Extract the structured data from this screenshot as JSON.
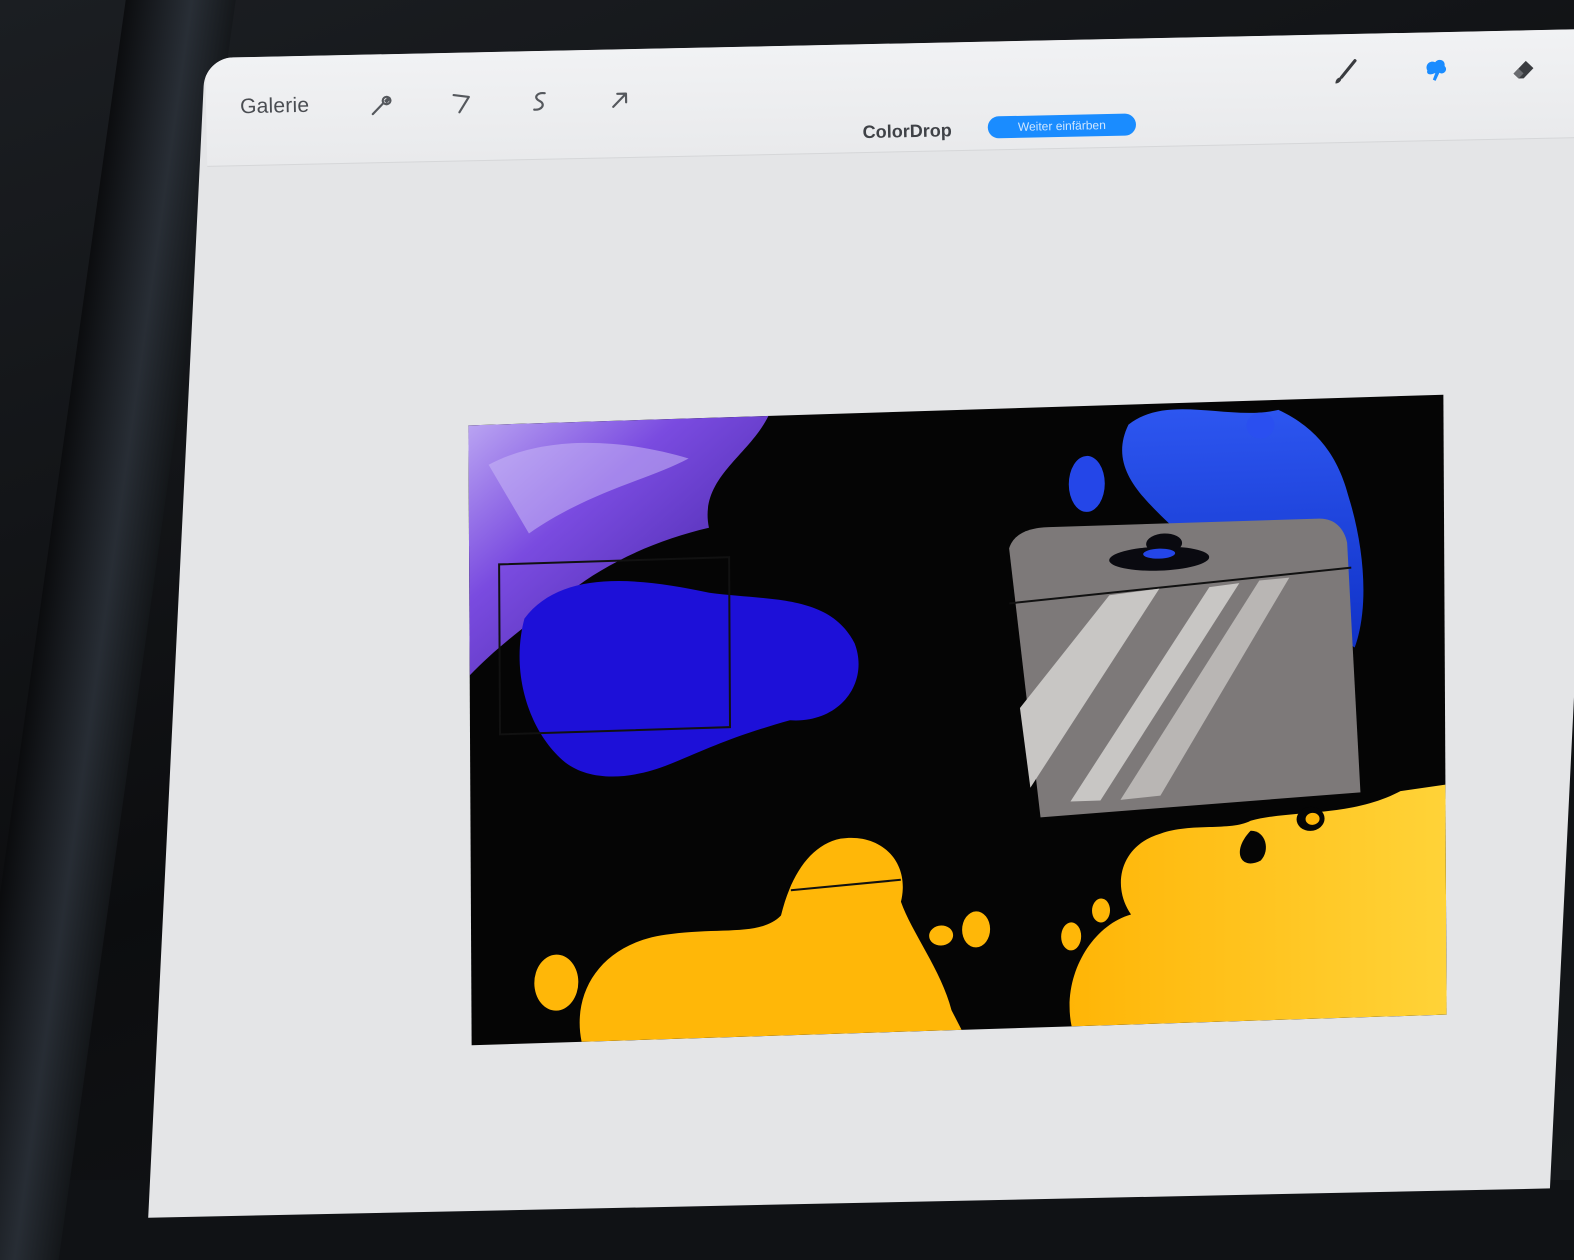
{
  "app": {
    "gallery_label": "Galerie",
    "mode_label": "ColorDrop",
    "mode_action_label": "Weiter einfärben"
  },
  "toolbar_left_icons": [
    "wrench-icon",
    "magic-wand-icon",
    "selection-icon",
    "transform-arrow-icon"
  ],
  "toolbar_right_icons": [
    "brush-icon",
    "smudge-icon",
    "eraser-icon"
  ],
  "colors": {
    "accent": "#1a8cff",
    "purple": "#6b3dd8",
    "blue": "#1a13d6",
    "royal_blue": "#1f48e0",
    "yellow": "#ffb80a",
    "gray_box": "#7a7676"
  }
}
